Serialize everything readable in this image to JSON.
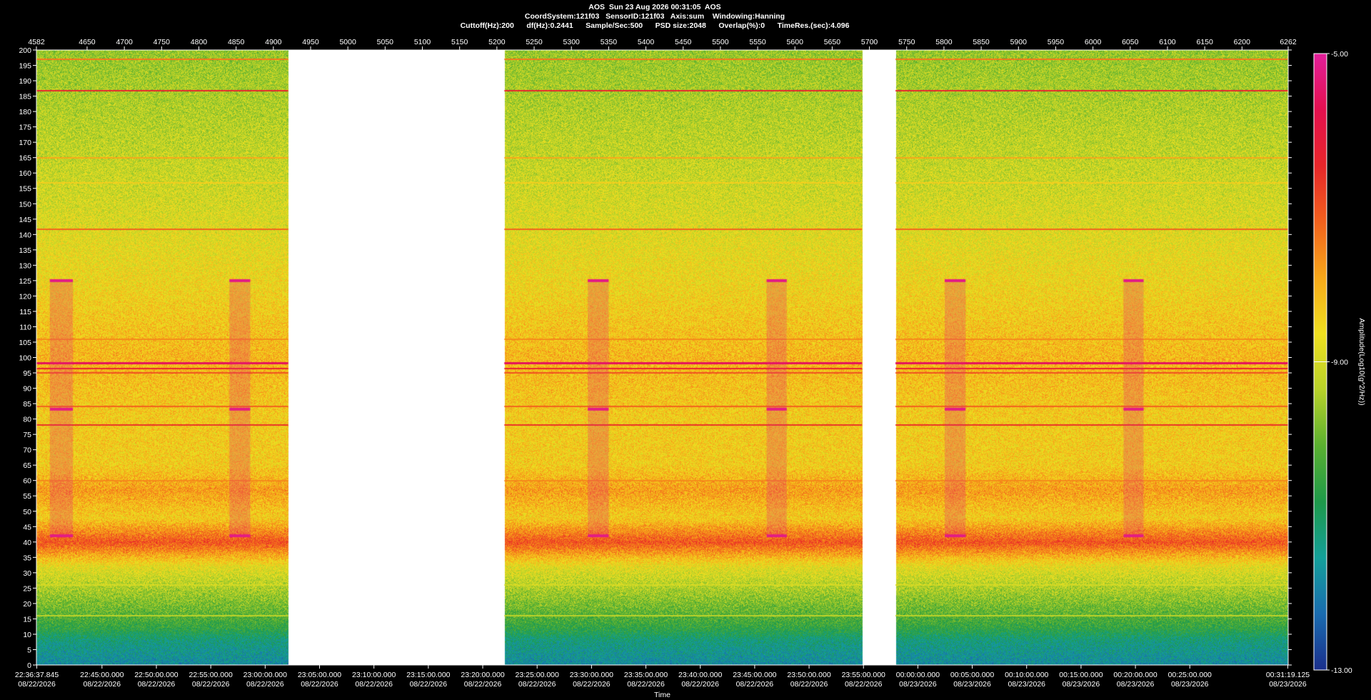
{
  "header": {
    "line1": "AOS  Sun 23 Aug 2026 00:31:05  AOS",
    "line2": "CoordSystem:121f03   SensorID:121f03   Axis:sum    Windowing:Hanning",
    "line3": "Cuttoff(Hz):200      df(Hz):0.2441      Sample/Sec:500      PSD size:2048      Overlap(%):0      TimeRes.(sec):4.096"
  },
  "chart_data": {
    "type": "heatmap",
    "title": "AOS  Sun 23 Aug 2026 00:31:05  AOS",
    "xlabel": "Time",
    "ylabel": "",
    "colorbar_label": "Amplitude(Log10(g^2/Hz))",
    "colorbar_ticks": [
      "-5.00",
      "-9.00",
      "-13.00"
    ],
    "colorbar_range": [
      -13,
      -5
    ],
    "colorscale": [
      "#1b2f8c",
      "#1a6cb0",
      "#14a09a",
      "#1e9a4a",
      "#5ab030",
      "#b8d22a",
      "#f0e020",
      "#f7a81a",
      "#f2611d",
      "#e8262a",
      "#e4104f",
      "#e21f9a"
    ],
    "ylim": [
      0,
      200
    ],
    "yticks": [
      0,
      5,
      10,
      15,
      20,
      25,
      30,
      35,
      40,
      45,
      50,
      55,
      60,
      65,
      70,
      75,
      80,
      85,
      90,
      95,
      100,
      105,
      110,
      115,
      120,
      125,
      130,
      135,
      140,
      145,
      150,
      155,
      160,
      165,
      170,
      175,
      180,
      185,
      190,
      195,
      200
    ],
    "xlim_top": [
      4582,
      6262
    ],
    "xticks_top": [
      4582,
      4650,
      4700,
      4750,
      4800,
      4850,
      4900,
      4950,
      5000,
      5050,
      5100,
      5150,
      5200,
      5250,
      5300,
      5350,
      5400,
      5450,
      5500,
      5550,
      5600,
      5650,
      5700,
      5750,
      5800,
      5850,
      5900,
      5950,
      6000,
      6050,
      6100,
      6150,
      6200,
      6262
    ],
    "xticks_bottom": [
      {
        "at": 4582.5,
        "time": "22:36:37.845",
        "date": "08/22/2026"
      },
      {
        "at": 4670,
        "time": "22:45:00.000",
        "date": "08/22/2026"
      },
      {
        "at": 4743,
        "time": "22:50:00.000",
        "date": "08/22/2026"
      },
      {
        "at": 4816,
        "time": "22:55:00.000",
        "date": "08/22/2026"
      },
      {
        "at": 4889,
        "time": "23:00:00.000",
        "date": "08/22/2026"
      },
      {
        "at": 4962,
        "time": "23:05:00.000",
        "date": "08/22/2026"
      },
      {
        "at": 5035,
        "time": "23:10:00.000",
        "date": "08/22/2026"
      },
      {
        "at": 5108,
        "time": "23:15:00.000",
        "date": "08/22/2026"
      },
      {
        "at": 5181,
        "time": "23:20:00.000",
        "date": "08/22/2026"
      },
      {
        "at": 5254,
        "time": "23:25:00.000",
        "date": "08/22/2026"
      },
      {
        "at": 5327,
        "time": "23:30:00.000",
        "date": "08/22/2026"
      },
      {
        "at": 5400,
        "time": "23:35:00.000",
        "date": "08/22/2026"
      },
      {
        "at": 5473,
        "time": "23:40:00.000",
        "date": "08/22/2026"
      },
      {
        "at": 5546,
        "time": "23:45:00.000",
        "date": "08/22/2026"
      },
      {
        "at": 5619,
        "time": "23:50:00.000",
        "date": "08/22/2026"
      },
      {
        "at": 5692,
        "time": "23:55:00.000",
        "date": "08/22/2026"
      },
      {
        "at": 5765,
        "time": "00:00:00.000",
        "date": "08/23/2026"
      },
      {
        "at": 5838,
        "time": "00:05:00.000",
        "date": "08/23/2026"
      },
      {
        "at": 5911,
        "time": "00:10:00.000",
        "date": "08/23/2026"
      },
      {
        "at": 5984,
        "time": "00:15:00.000",
        "date": "08/23/2026"
      },
      {
        "at": 6057,
        "time": "00:20:00.000",
        "date": "08/23/2026"
      },
      {
        "at": 6130,
        "time": "00:25:00.000",
        "date": "08/23/2026"
      },
      {
        "at": 6261.5,
        "time": "00:31:19.125",
        "date": "08/23/2026"
      }
    ],
    "data_segments": [
      [
        4582,
        4920
      ],
      [
        5210,
        5690
      ],
      [
        5735,
        6262
      ]
    ],
    "grid": false,
    "legend": "none",
    "background_level": [
      [
        0,
        -11.8
      ],
      [
        8,
        -11.3
      ],
      [
        12,
        -10.6
      ],
      [
        18,
        -10.0
      ],
      [
        25,
        -9.4
      ],
      [
        32,
        -8.8
      ],
      [
        40,
        -7.0
      ],
      [
        48,
        -8.4
      ],
      [
        57,
        -7.8
      ],
      [
        65,
        -8.4
      ],
      [
        80,
        -8.4
      ],
      [
        100,
        -8.1
      ],
      [
        125,
        -8.6
      ],
      [
        150,
        -9.0
      ],
      [
        175,
        -9.3
      ],
      [
        200,
        -9.6
      ]
    ],
    "tones": [
      {
        "freq": 197.0,
        "level": -7.4
      },
      {
        "freq": 186.7,
        "level": -6.4
      },
      {
        "freq": 165.0,
        "level": -7.9
      },
      {
        "freq": 156.8,
        "level": -8.4
      },
      {
        "freq": 141.6,
        "level": -7.2
      },
      {
        "freq": 106.0,
        "level": -7.6
      },
      {
        "freq": 98.3,
        "level": -5.6
      },
      {
        "freq": 96.5,
        "level": -6.4
      },
      {
        "freq": 95.0,
        "level": -7.0
      },
      {
        "freq": 84.0,
        "level": -7.2
      },
      {
        "freq": 78.0,
        "level": -6.6
      },
      {
        "freq": 60.0,
        "level": -7.6
      },
      {
        "freq": 26.0,
        "level": -9.0
      },
      {
        "freq": 16.0,
        "level": -9.3
      }
    ],
    "bursts": [
      {
        "x": [
          4600,
          4631
        ],
        "freqs": [
          125.0,
          83.2,
          42.0
        ],
        "level": -5.2
      },
      {
        "x": [
          4841,
          4869
        ],
        "freqs": [
          125.0,
          83.2,
          42.0
        ],
        "level": -5.2
      },
      {
        "x": [
          5322,
          5350
        ],
        "freqs": [
          125.0,
          83.2,
          42.0
        ],
        "level": -5.2
      },
      {
        "x": [
          5562,
          5589
        ],
        "freqs": [
          125.0,
          83.2,
          42.0
        ],
        "level": -5.2
      },
      {
        "x": [
          5801,
          5829
        ],
        "freqs": [
          125.0,
          83.2,
          42.0
        ],
        "level": -5.2
      },
      {
        "x": [
          6041,
          6068
        ],
        "freqs": [
          125.0,
          83.2,
          42.0
        ],
        "level": -5.2
      }
    ]
  }
}
